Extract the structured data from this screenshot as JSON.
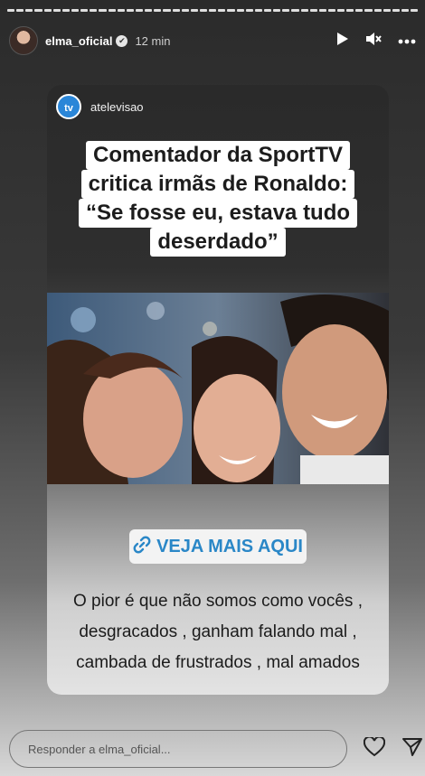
{
  "story": {
    "segments": 45
  },
  "header": {
    "username": "elma_oficial",
    "verified_glyph": "✔",
    "time": "12 min",
    "play_icon": "▶",
    "mute_icon": "🔇",
    "more_icon": "•••"
  },
  "post": {
    "source_logo_text": "tv",
    "source_name": "atelevisao",
    "headline_lines": [
      "Comentador da SportTV",
      "critica irmãs de Ronaldo:",
      "“Se fosse eu, estava tudo",
      "deserdado”"
    ]
  },
  "link_sticker": {
    "label": "VEJA MAIS AQUI"
  },
  "caption_lines": [
    "O pior é que não somos como vocês ,",
    "desgracados , ganham falando mal ,",
    "cambada de frustrados , mal amados"
  ],
  "footer": {
    "reply_placeholder": "Responder a elma_oficial..."
  }
}
